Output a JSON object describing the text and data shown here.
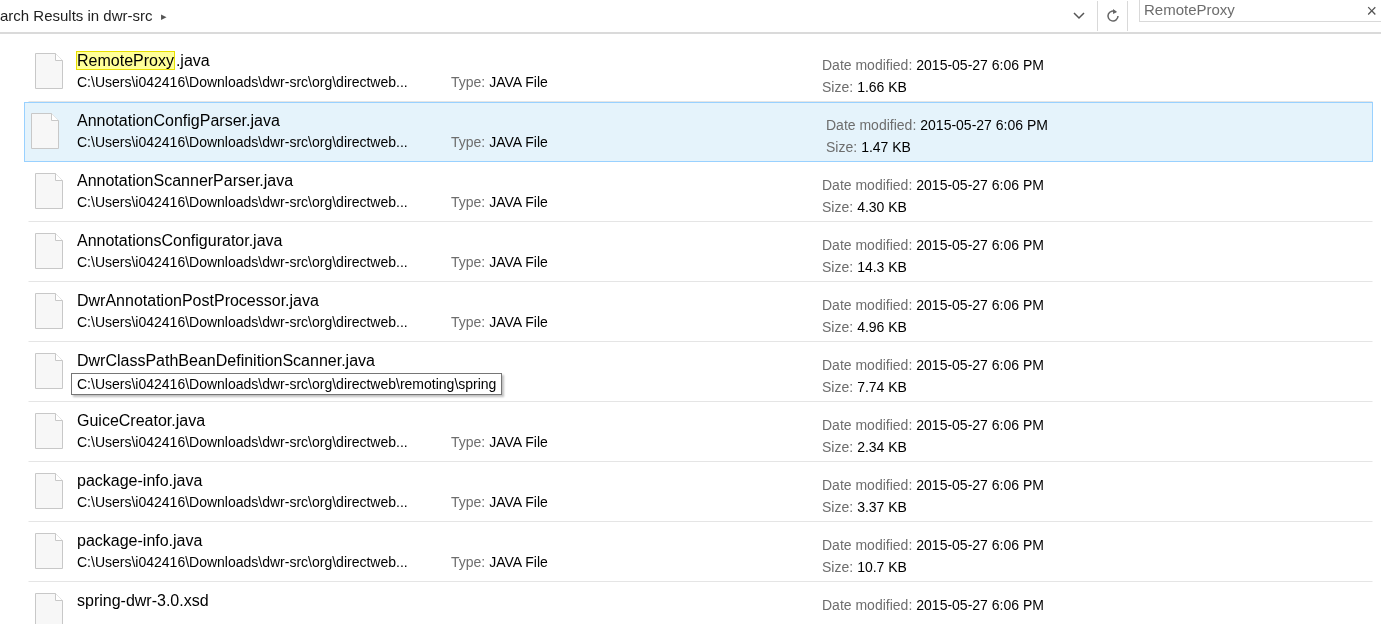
{
  "address_bar": {
    "breadcrumb": "arch Results in dwr-src",
    "separator": "▸"
  },
  "search": {
    "value": "RemoteProxy",
    "clear": "×"
  },
  "rows": [
    {
      "name": [
        {
          "text": "RemoteProxy",
          "highlighted": true
        },
        {
          "text": ".java",
          "highlighted": false
        }
      ],
      "selected": false,
      "path": "C:\\Users\\i042416\\Downloads\\dwr-src\\org\\directweb...",
      "type_label": "Type:",
      "type": "JAVA File",
      "date_label": "Date modified:",
      "date": "2015-05-27 6:06 PM",
      "size_label": "Size:",
      "size": "1.66 KB"
    },
    {
      "name": [
        {
          "text": "AnnotationConfigParser.java",
          "highlighted": false
        }
      ],
      "selected": true,
      "path": "C:\\Users\\i042416\\Downloads\\dwr-src\\org\\directweb...",
      "type_label": "Type:",
      "type": "JAVA File",
      "date_label": "Date modified:",
      "date": "2015-05-27 6:06 PM",
      "size_label": "Size:",
      "size": "1.47 KB"
    },
    {
      "name": [
        {
          "text": "AnnotationScannerParser.java",
          "highlighted": false
        }
      ],
      "selected": false,
      "path": "C:\\Users\\i042416\\Downloads\\dwr-src\\org\\directweb...",
      "type_label": "Type:",
      "type": "JAVA File",
      "date_label": "Date modified:",
      "date": "2015-05-27 6:06 PM",
      "size_label": "Size:",
      "size": "4.30 KB"
    },
    {
      "name": [
        {
          "text": "AnnotationsConfigurator.java",
          "highlighted": false
        }
      ],
      "selected": false,
      "path": "C:\\Users\\i042416\\Downloads\\dwr-src\\org\\directweb...",
      "type_label": "Type:",
      "type": "JAVA File",
      "date_label": "Date modified:",
      "date": "2015-05-27 6:06 PM",
      "size_label": "Size:",
      "size": "14.3 KB"
    },
    {
      "name": [
        {
          "text": "DwrAnnotationPostProcessor.java",
          "highlighted": false
        }
      ],
      "selected": false,
      "path": "C:\\Users\\i042416\\Downloads\\dwr-src\\org\\directweb...",
      "type_label": "Type:",
      "type": "JAVA File",
      "date_label": "Date modified:",
      "date": "2015-05-27 6:06 PM",
      "size_label": "Size:",
      "size": "4.96 KB"
    },
    {
      "name": [
        {
          "text": "DwrClassPathBeanDefinitionScanner.java",
          "highlighted": false
        }
      ],
      "selected": false,
      "tooltip": "C:\\Users\\i042416\\Downloads\\dwr-src\\org\\directweb\\remoting\\spring",
      "date_label": "Date modified:",
      "date": "2015-05-27 6:06 PM",
      "size_label": "Size:",
      "size": "7.74 KB"
    },
    {
      "name": [
        {
          "text": "GuiceCreator.java",
          "highlighted": false
        }
      ],
      "selected": false,
      "path": "C:\\Users\\i042416\\Downloads\\dwr-src\\org\\directweb...",
      "type_label": "Type:",
      "type": "JAVA File",
      "date_label": "Date modified:",
      "date": "2015-05-27 6:06 PM",
      "size_label": "Size:",
      "size": "2.34 KB"
    },
    {
      "name": [
        {
          "text": "package-info.java",
          "highlighted": false
        }
      ],
      "selected": false,
      "path": "C:\\Users\\i042416\\Downloads\\dwr-src\\org\\directweb...",
      "type_label": "Type:",
      "type": "JAVA File",
      "date_label": "Date modified:",
      "date": "2015-05-27 6:06 PM",
      "size_label": "Size:",
      "size": "3.37 KB"
    },
    {
      "name": [
        {
          "text": "package-info.java",
          "highlighted": false
        }
      ],
      "selected": false,
      "path": "C:\\Users\\i042416\\Downloads\\dwr-src\\org\\directweb...",
      "type_label": "Type:",
      "type": "JAVA File",
      "date_label": "Date modified:",
      "date": "2015-05-27 6:06 PM",
      "size_label": "Size:",
      "size": "10.7 KB"
    },
    {
      "name": [
        {
          "text": "spring-dwr-3.0.xsd",
          "highlighted": false
        }
      ],
      "selected": false,
      "date_label": "Date modified:",
      "date": "2015-05-27 6:06 PM"
    }
  ]
}
